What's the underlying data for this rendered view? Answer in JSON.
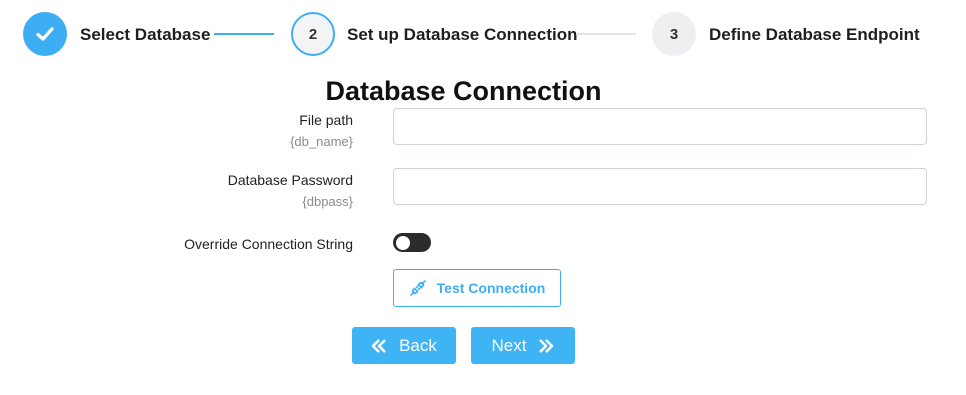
{
  "stepper": {
    "steps": [
      {
        "number": "",
        "label": "Select Database",
        "state": "done"
      },
      {
        "number": "2",
        "label": "Set up Database Connection",
        "state": "active"
      },
      {
        "number": "3",
        "label": "Define Database Endpoint",
        "state": "pending"
      }
    ]
  },
  "form": {
    "title": "Database Connection",
    "file_path": {
      "label": "File path",
      "hint": "{db_name}",
      "value": ""
    },
    "password": {
      "label": "Database Password",
      "hint": "{dbpass}",
      "value": ""
    },
    "override": {
      "label": "Override Connection String",
      "enabled": false
    }
  },
  "buttons": {
    "test_connection": "Test Connection",
    "back": "Back",
    "next": "Next"
  },
  "colors": {
    "accent": "#3eaef4",
    "toggle_off": "#2b2b2b"
  },
  "icons": {
    "step1": "checkmark-icon",
    "test": "plug-connection-icon",
    "back": "double-chevron-left-icon",
    "next": "double-chevron-right-icon"
  }
}
